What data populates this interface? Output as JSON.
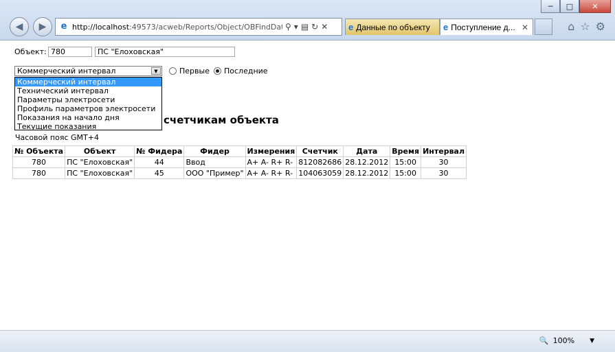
{
  "browser": {
    "window_controls": {
      "minimize": "─",
      "maximize": "□",
      "close": "✕"
    },
    "address": {
      "host": "http://localhost",
      "rest": ":49573/acweb/Reports/Object/OBFindData"
    },
    "tabs": [
      {
        "title": "Данные по объекту"
      },
      {
        "title": "Поступление д..."
      }
    ],
    "zoom": "100%"
  },
  "form": {
    "object_label": "Объект:",
    "object_id": "780",
    "object_name": "ПС \"Елоховская\"",
    "select": {
      "value": "Коммерческий интервал",
      "options": [
        "Коммерческий интервал",
        "Технический интервал",
        "Параметры электросети",
        "Профиль параметров электросети",
        "Показания на начало дня",
        "Текущие показания"
      ]
    },
    "radio_first": "Первые",
    "radio_last": "Последние"
  },
  "report": {
    "heading": "счетчикам объекта",
    "timezone": "Часовой пояс GMT+4",
    "columns": [
      "№ Объекта",
      "Объект",
      "№ Фидера",
      "Фидер",
      "Измерения",
      "Счетчик",
      "Дата",
      "Время",
      "Интервал"
    ],
    "rows": [
      [
        "780",
        "ПС \"Елоховская\"",
        "44",
        "Ввод",
        "A+ A- R+ R-",
        "812082686",
        "28.12.2012",
        "15:00",
        "30"
      ],
      [
        "780",
        "ПС \"Елоховская\"",
        "45",
        "ООО \"Пример\"",
        "A+ A- R+ R-",
        "104063059",
        "28.12.2012",
        "15:00",
        "30"
      ]
    ]
  }
}
